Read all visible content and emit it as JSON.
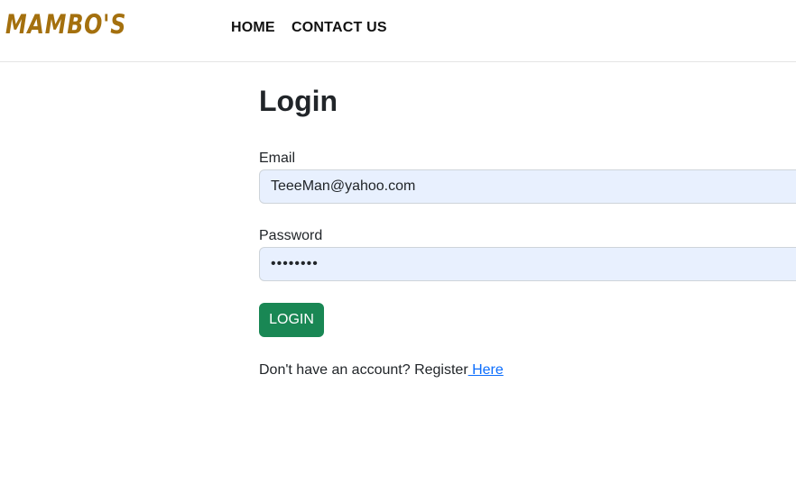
{
  "brand": {
    "logo_text": "MAMBO'S",
    "color": "#a4700e"
  },
  "nav": {
    "items": [
      {
        "label": "HOME"
      },
      {
        "label": "CONTACT US"
      }
    ]
  },
  "login": {
    "title": "Login",
    "email": {
      "label": "Email",
      "value": "TeeeMan@yahoo.com"
    },
    "password": {
      "label": "Password",
      "value": "••••••••"
    },
    "submit_label": "LOGIN",
    "register_prompt": "Don't have an account? Register",
    "register_link": " Here"
  },
  "colors": {
    "accent_green": "#198754",
    "input_background": "#e8f0fe",
    "link_blue": "#0d6efd"
  }
}
